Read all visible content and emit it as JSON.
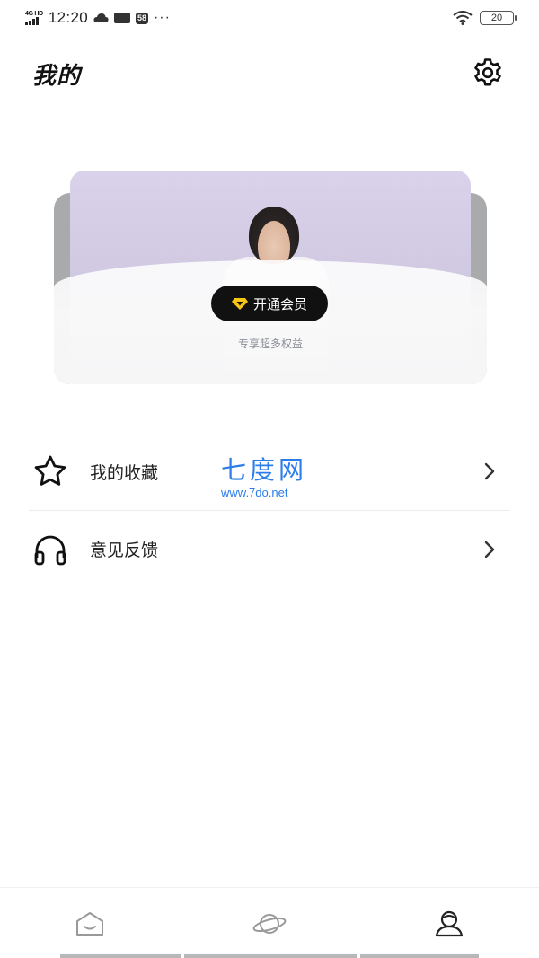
{
  "status_bar": {
    "network": "4G HD",
    "time": "12:20",
    "badge": "58",
    "more": "···",
    "battery": "20"
  },
  "header": {
    "title": "我的"
  },
  "vip_banner": {
    "button_label": "开通会员",
    "subtitle": "专享超多权益"
  },
  "menu": {
    "items": [
      {
        "label": "我的收藏",
        "icon": "star-icon"
      },
      {
        "label": "意见反馈",
        "icon": "headphones-icon"
      }
    ]
  },
  "watermark": {
    "title": "七度网",
    "url": "www.7do.net"
  },
  "bottom_nav": {
    "items": [
      {
        "icon": "home-icon",
        "active": false
      },
      {
        "icon": "planet-icon",
        "active": false
      },
      {
        "icon": "profile-icon",
        "active": true
      }
    ]
  },
  "colors": {
    "accent_black": "#111111",
    "vip_diamond": "#f5c518",
    "watermark_blue": "#2b7de9"
  }
}
